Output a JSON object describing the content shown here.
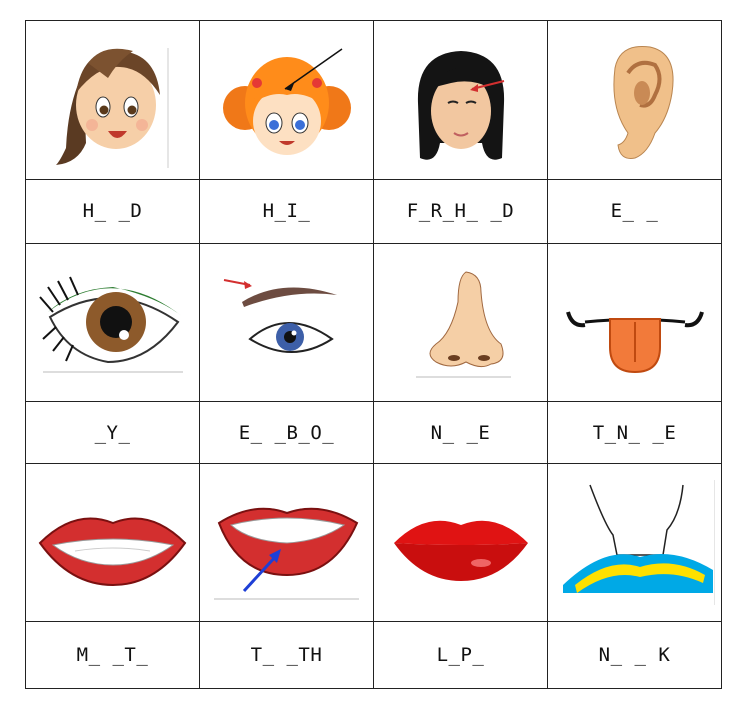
{
  "worksheet": {
    "rows": [
      {
        "cells": [
          {
            "icon": "girl-head-icon",
            "word": "H_ _D"
          },
          {
            "icon": "girl-hair-icon",
            "word": "H_I_"
          },
          {
            "icon": "forehead-icon",
            "word": "F_R_H_ _D"
          },
          {
            "icon": "ear-icon",
            "word": "E_ _"
          }
        ]
      },
      {
        "cells": [
          {
            "icon": "eye-icon",
            "word": "_Y_"
          },
          {
            "icon": "eyebrow-icon",
            "word": "E_ _B_O_"
          },
          {
            "icon": "nose-icon",
            "word": "N_ _E"
          },
          {
            "icon": "tongue-icon",
            "word": "T_N_ _E"
          }
        ]
      },
      {
        "cells": [
          {
            "icon": "smiling-mouth-icon",
            "word": "M_ _T_"
          },
          {
            "icon": "teeth-icon",
            "word": "T_ _TH"
          },
          {
            "icon": "lips-icon",
            "word": "L_P_"
          },
          {
            "icon": "neck-icon",
            "word": "N_ _ K"
          }
        ]
      }
    ]
  }
}
